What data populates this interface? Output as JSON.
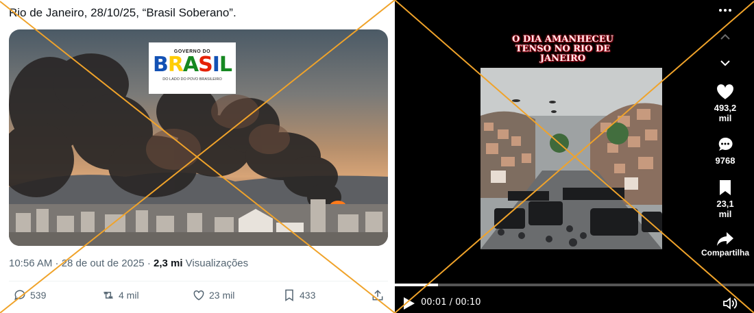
{
  "tweet": {
    "text": "Rio de Janeiro, 28/10/25, “Brasil Soberano”.",
    "logo": {
      "top_text": "GOVERNO DO",
      "word_letters": [
        "B",
        "R",
        "A",
        "S",
        "I",
        "L"
      ],
      "bottom_text": "DO LADO DO POVO BRASILEIRO"
    },
    "meta_time": "10:56 AM · 28 de out de 2025 · ",
    "meta_views_count": "2,3 mi",
    "meta_views_label": " Visualizações",
    "actions": {
      "replies": "539",
      "reposts": "4 mil",
      "likes": "23 mil",
      "bookmarks": "433"
    }
  },
  "video": {
    "title": "O DIA AMANHECEU TENSO NO RIO DE JANEIRO",
    "likes": "493,2\nmil",
    "comments": "9768",
    "saves": "23,1\nmil",
    "share_label": "Compartilha",
    "time": "00:01 / 00:10",
    "progress": 0.12
  },
  "colors": {
    "overlay_cross": "#f0a32a",
    "text_secondary": "#536471",
    "video_bg": "#000000"
  }
}
